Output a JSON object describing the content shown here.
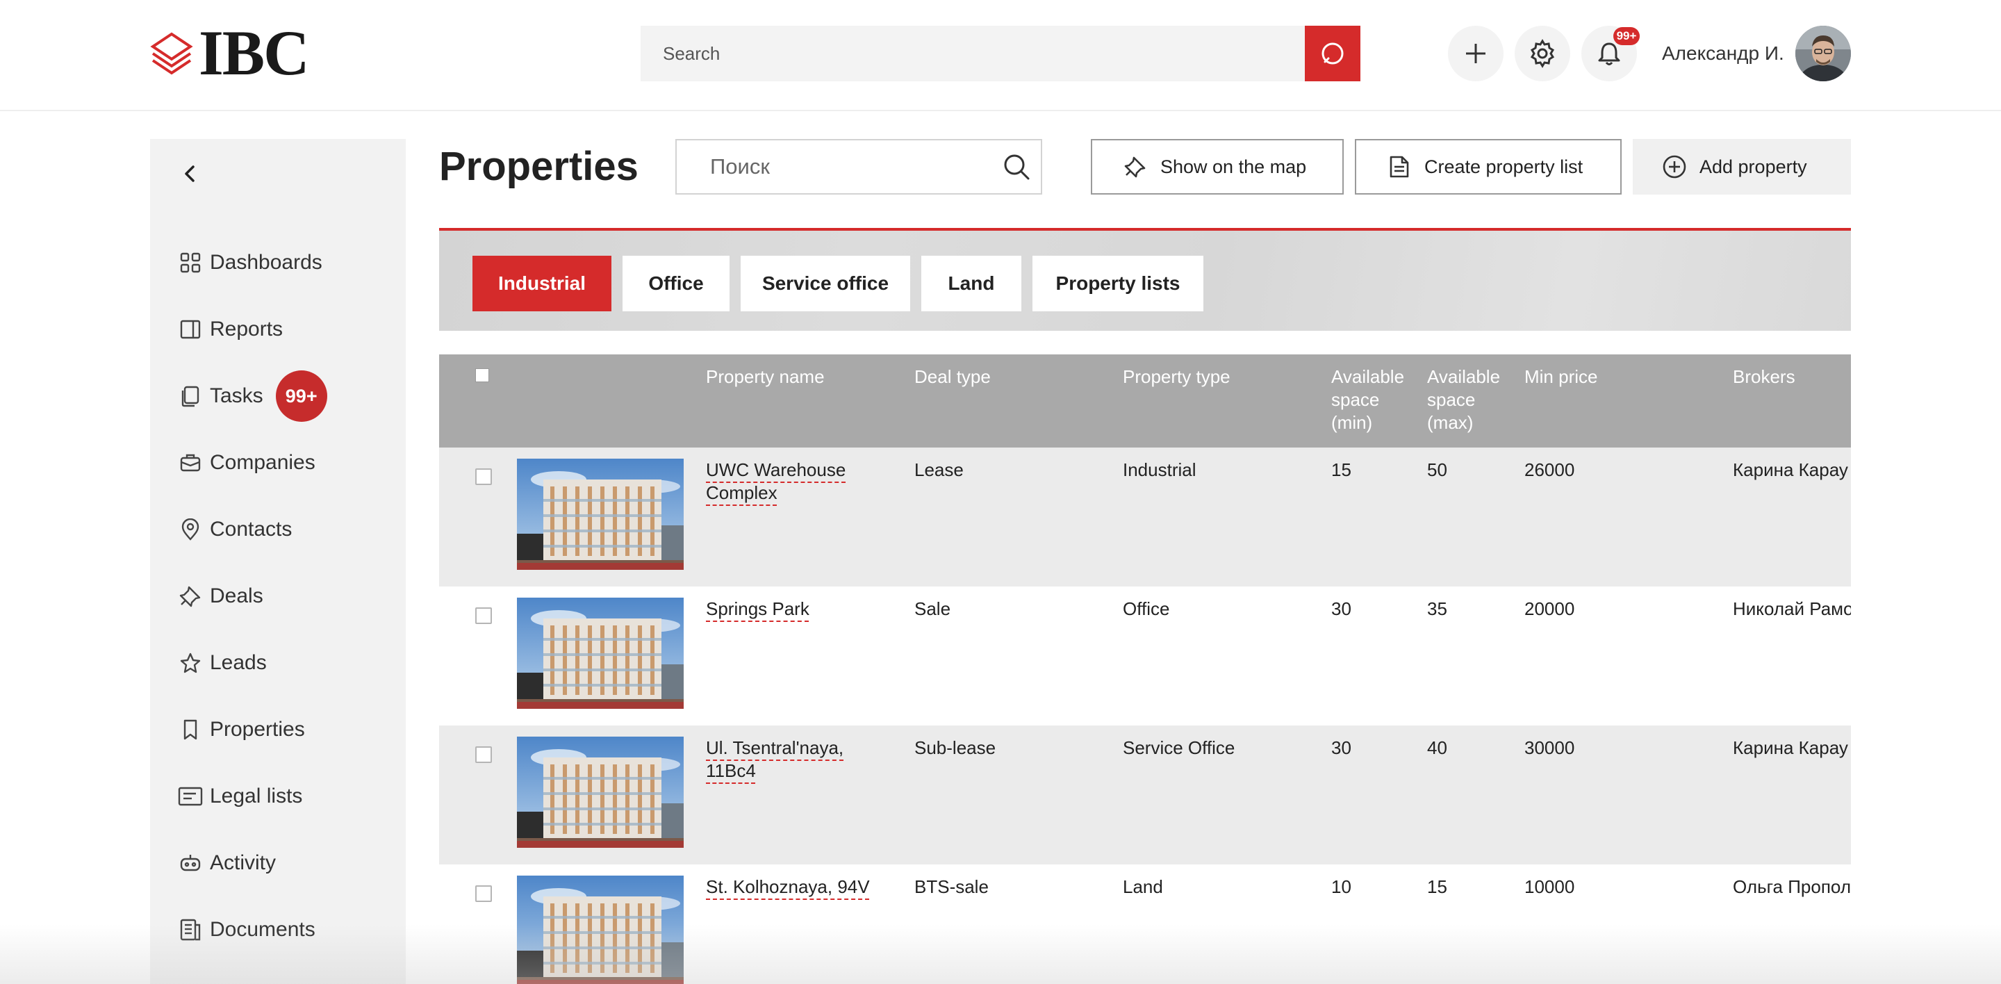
{
  "header": {
    "logo_text": "IBC",
    "search_placeholder": "Search",
    "notifications_badge": "99+",
    "user_name": "Александр И."
  },
  "sidebar": {
    "items": [
      {
        "label": "Dashboards",
        "icon": "grid-icon"
      },
      {
        "label": "Reports",
        "icon": "report-icon"
      },
      {
        "label": "Tasks",
        "icon": "clipboard-icon",
        "badge": "99+"
      },
      {
        "label": "Companies",
        "icon": "briefcase-icon"
      },
      {
        "label": "Contacts",
        "icon": "location-pin-icon"
      },
      {
        "label": "Deals",
        "icon": "pin-icon"
      },
      {
        "label": "Leads",
        "icon": "star-icon"
      },
      {
        "label": "Properties",
        "icon": "bookmark-icon"
      },
      {
        "label": "Legal lists",
        "icon": "legal-list-icon"
      },
      {
        "label": "Activity",
        "icon": "activity-icon"
      },
      {
        "label": "Documents",
        "icon": "documents-icon"
      }
    ]
  },
  "main": {
    "title": "Properties",
    "search_placeholder": "Поиск",
    "actions": {
      "show_map": "Show on the map",
      "create_list": "Create property list",
      "add_property": "Add property"
    },
    "tabs": [
      "Industrial",
      "Office",
      "Service office",
      "Land",
      "Property lists"
    ],
    "active_tab": "Industrial"
  },
  "table": {
    "columns": {
      "name": "Property name",
      "deal": "Deal type",
      "type": "Property type",
      "space_min": "Available space (min)",
      "space_max": "Available space (max)",
      "price": "Min price",
      "brokers": "Brokers"
    },
    "rows": [
      {
        "name": "UWC Warehouse Complex",
        "deal": "Lease",
        "type": "Industrial",
        "space_min": "15",
        "space_max": "50",
        "price": "26000",
        "broker": "Карина Карау"
      },
      {
        "name": "Springs Park",
        "deal": "Sale",
        "type": "Office",
        "space_min": "30",
        "space_max": "35",
        "price": "20000",
        "broker": "Николай Рамо"
      },
      {
        "name": "Ul. Tsentral'naya, 11Bc4",
        "deal": "Sub-lease",
        "type": "Service Office",
        "space_min": "30",
        "space_max": "40",
        "price": "30000",
        "broker": "Карина Карау"
      },
      {
        "name": "St. Kolhoznaya, 94V",
        "deal": "BTS-sale",
        "type": "Land",
        "space_min": "10",
        "space_max": "15",
        "price": "10000",
        "broker": "Ольга Пропол"
      }
    ]
  },
  "colors": {
    "accent": "#d52b2b",
    "header_gray": "#a9a9a9",
    "sidebar_bg": "#f2f2f2",
    "row_shade": "#ebebeb"
  }
}
